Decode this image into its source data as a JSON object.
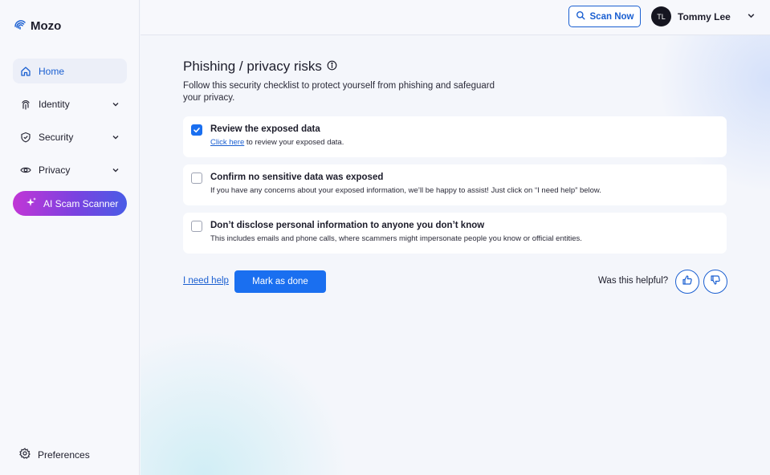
{
  "brand": {
    "name": "Mozo"
  },
  "sidebar": {
    "items": [
      {
        "label": "Home",
        "icon": "home-icon",
        "active": true
      },
      {
        "label": "Identity",
        "icon": "fingerprint-icon"
      },
      {
        "label": "Security",
        "icon": "shield-icon"
      },
      {
        "label": "Privacy",
        "icon": "eye-icon"
      }
    ],
    "ai_button": "AI Scam Scanner",
    "preferences": "Preferences"
  },
  "header": {
    "scan_button": "Scan Now",
    "user_initials": "TL",
    "user_name": "Tommy Lee"
  },
  "main": {
    "title": "Phishing / privacy risks",
    "subtitle": "Follow this security checklist to protect yourself from phishing and safeguard your privacy.",
    "checklist": [
      {
        "title": "Review the exposed data",
        "link": "Click here",
        "desc": " to review your exposed data.",
        "checked": true
      },
      {
        "title": "Confirm no sensitive data was exposed",
        "desc": "If you have any concerns about your exposed information, we’ll be happy to assist! Just click on “I need help” below.",
        "checked": false
      },
      {
        "title": "Don’t disclose personal information to anyone you don’t know",
        "desc": "This includes emails and phone calls, where scammers might impersonate people you know or official entities.",
        "checked": false
      }
    ],
    "help_link": "I need help",
    "done_button": "Mark as done",
    "helpful_label": "Was this helpful?"
  },
  "colors": {
    "accent": "#1a6ff0",
    "link": "#1a5fd1",
    "ai_start": "#c136d6",
    "ai_end": "#4a5ce6"
  }
}
